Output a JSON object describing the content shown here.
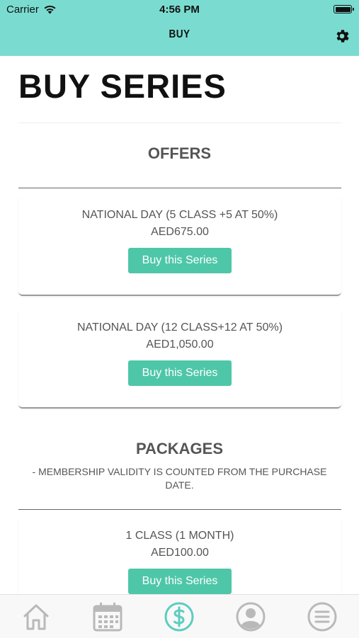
{
  "status_bar": {
    "carrier": "Carrier",
    "time": "4:56 PM"
  },
  "nav": {
    "title": "BUY"
  },
  "page": {
    "title": "BUY SERIES"
  },
  "offers": {
    "heading": "OFFERS",
    "items": [
      {
        "name": "NATIONAL DAY (5 CLASS +5 AT 50%)",
        "price": "AED675.00",
        "button": "Buy this Series"
      },
      {
        "name": "NATIONAL DAY (12 CLASS+12 AT 50%)",
        "price": "AED1,050.00",
        "button": "Buy this Series"
      }
    ]
  },
  "packages": {
    "heading": "PACKAGES",
    "note": "- MEMBERSHIP VALIDITY IS COUNTED FROM THE PURCHASE DATE.",
    "items": [
      {
        "name": "1 CLASS (1 MONTH)",
        "price": "AED100.00",
        "button": "Buy this Series"
      }
    ]
  },
  "tabs": [
    {
      "icon": "home-icon",
      "active": false
    },
    {
      "icon": "calendar-icon",
      "active": false
    },
    {
      "icon": "dollar-icon",
      "active": true
    },
    {
      "icon": "profile-icon",
      "active": false
    },
    {
      "icon": "menu-icon",
      "active": false
    }
  ],
  "colors": {
    "header_bg": "#7adcd1",
    "button_bg": "#4ec7a8",
    "active_tab": "#5ccdc0",
    "inactive_tab": "#b9b9b9"
  }
}
